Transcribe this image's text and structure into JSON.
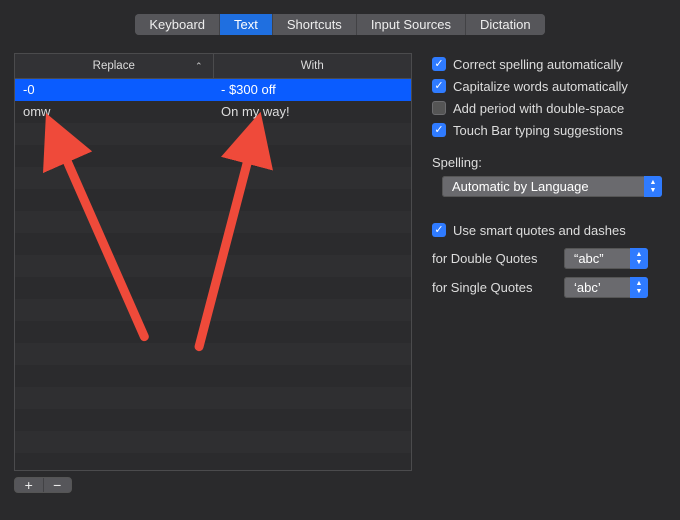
{
  "tabs": {
    "items": [
      "Keyboard",
      "Text",
      "Shortcuts",
      "Input Sources",
      "Dictation"
    ],
    "active_index": 1
  },
  "table": {
    "col_replace": "Replace",
    "col_with": "With",
    "rows": [
      {
        "replace": "-0",
        "with": "- $300 off",
        "selected": true
      },
      {
        "replace": "omw",
        "with": "On my way!",
        "selected": false
      }
    ]
  },
  "buttons": {
    "add": "+",
    "remove": "−"
  },
  "checks": {
    "correct_spelling": {
      "label": "Correct spelling automatically",
      "checked": true
    },
    "capitalize_words": {
      "label": "Capitalize words automatically",
      "checked": true
    },
    "add_period": {
      "label": "Add period with double-space",
      "checked": false
    },
    "touchbar": {
      "label": "Touch Bar typing suggestions",
      "checked": true
    },
    "smart_quotes": {
      "label": "Use smart quotes and dashes",
      "checked": true
    }
  },
  "spelling": {
    "label": "Spelling:",
    "value": "Automatic by Language"
  },
  "quotes": {
    "double_label": "for Double Quotes",
    "double_value": "“abc”",
    "single_label": "for Single Quotes",
    "single_value": "‘abc’"
  },
  "glyphs": {
    "check": "✓",
    "sort_asc": "⌃",
    "tri_up": "▲",
    "tri_down": "▼"
  }
}
